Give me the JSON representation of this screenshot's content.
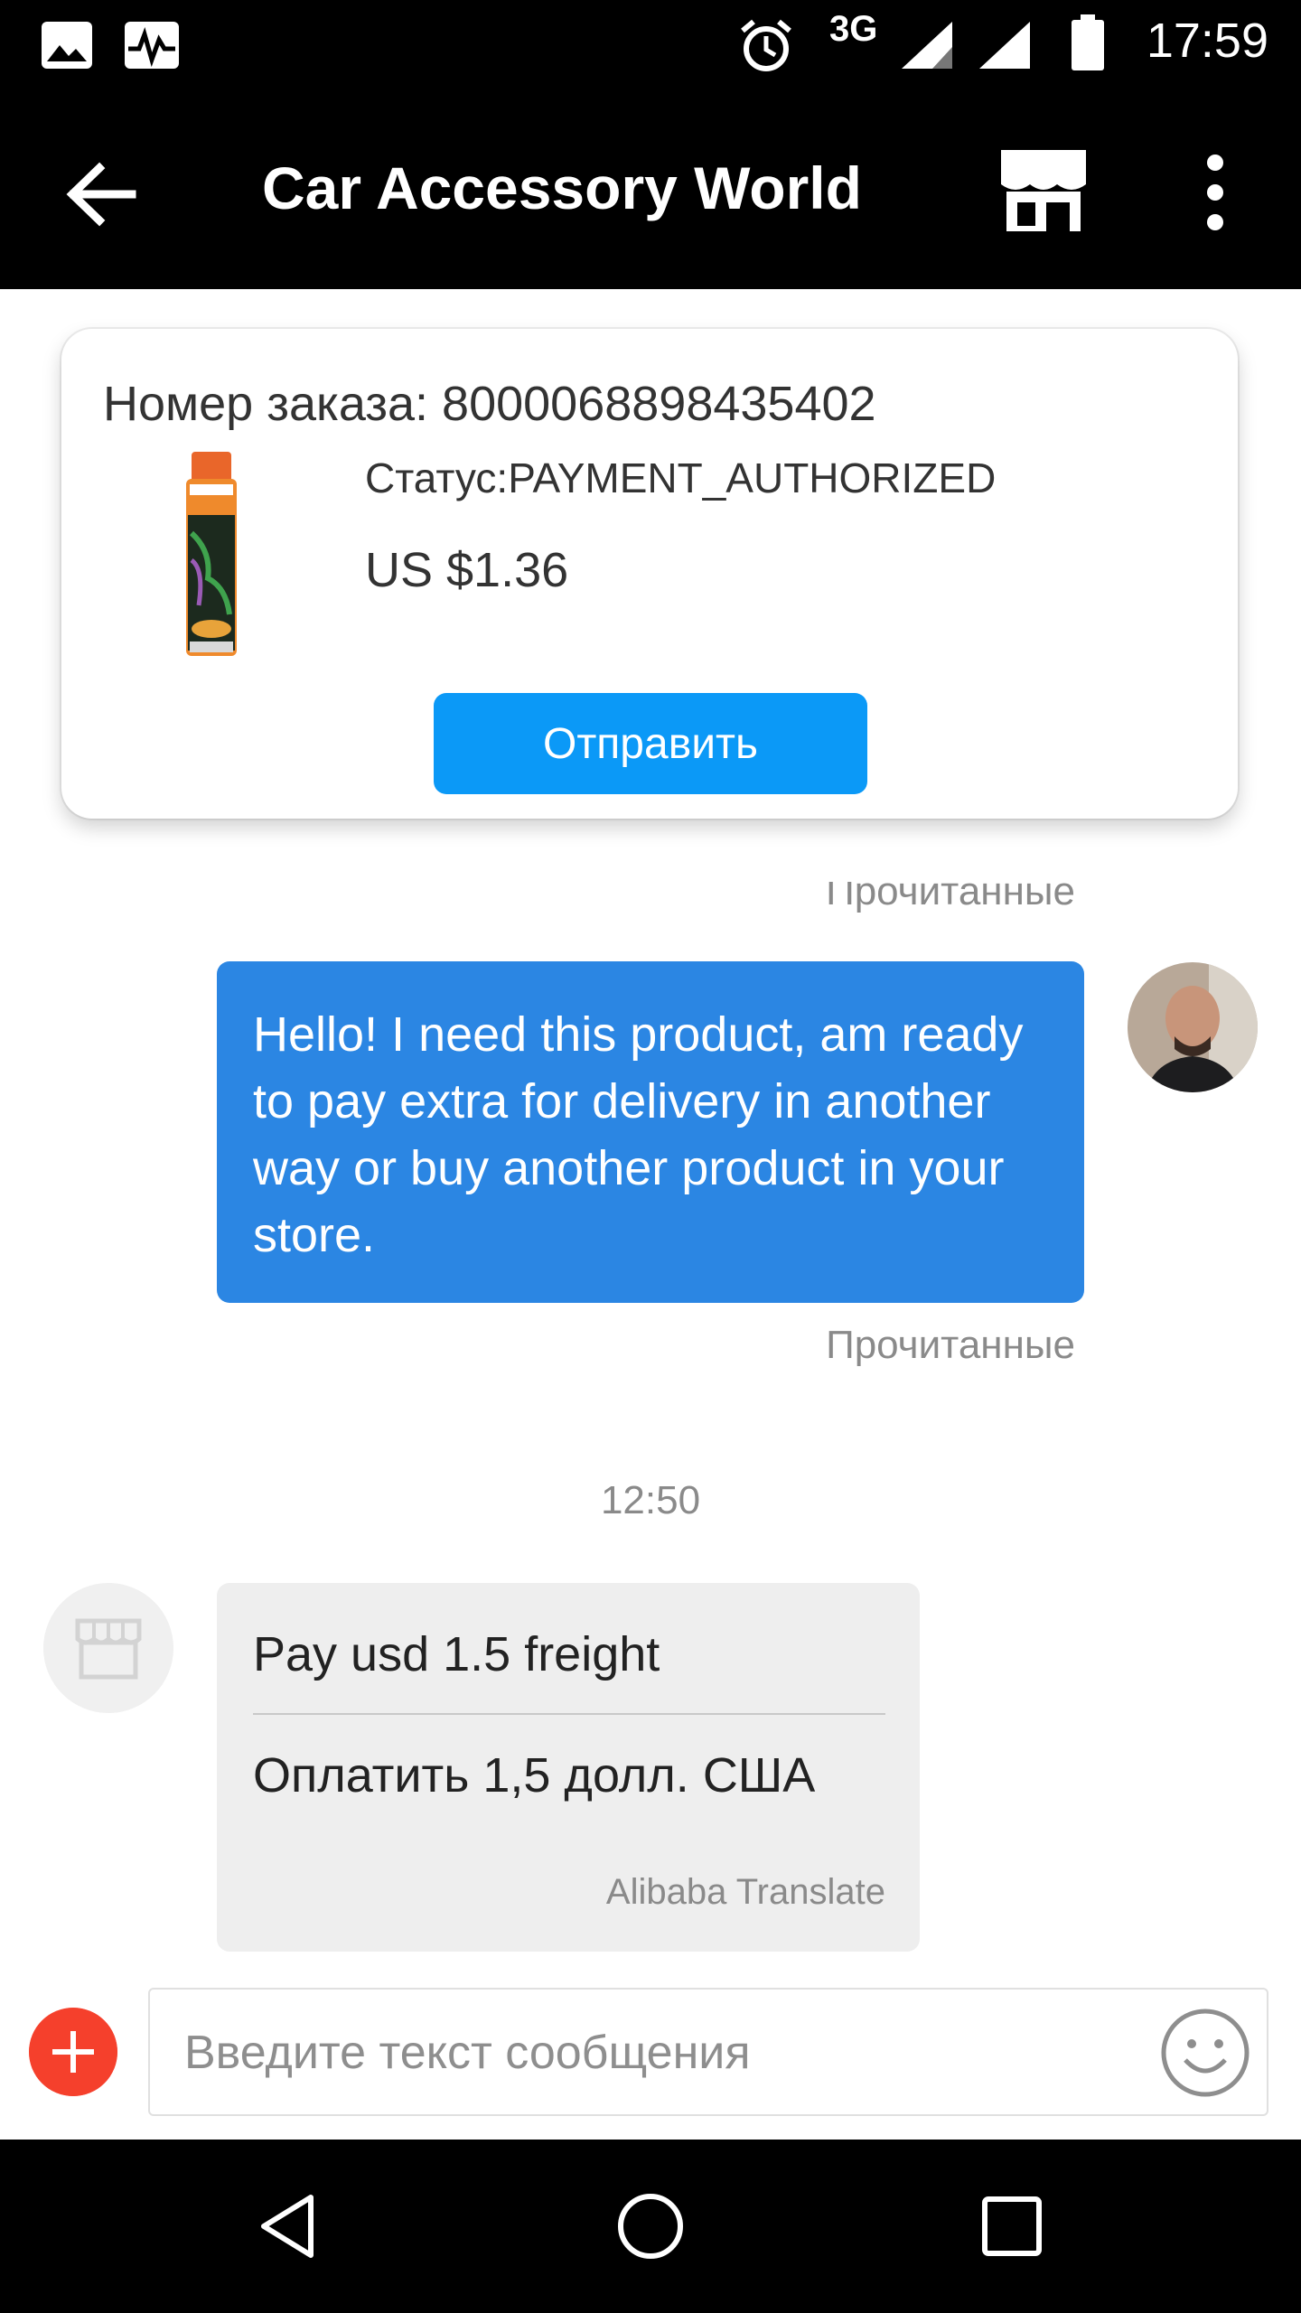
{
  "status_bar": {
    "time": "17:59",
    "network": "3G",
    "icons": [
      "image-icon",
      "activity-icon",
      "alarm-icon",
      "signal-icon",
      "signal-icon",
      "battery-icon"
    ]
  },
  "app_bar": {
    "title": "Car Accessory World",
    "icons": [
      "back-arrow-icon",
      "store-icon",
      "more-vertical-icon"
    ]
  },
  "order_card": {
    "order_number": "Номер заказа: 8000068898435402",
    "status": "Статус:PAYMENT_AUTHORIZED",
    "price": "US $1.36",
    "send_label": "Отправить"
  },
  "messages": {
    "read_label_top": "Прочитанные",
    "outgoing_text": "Hello!  I need this product, am ready to pay extra for delivery in another way or buy another product in your store.",
    "read_label_bottom": "Прочитанные",
    "timestamp": "12:50",
    "incoming_original": "Pay usd 1.5 freight",
    "incoming_translated": "Оплатить 1,5 долл. США",
    "translate_credit": "Alibaba Translate"
  },
  "input_bar": {
    "placeholder": "Введите текст сообщения",
    "add_icon": "plus-icon",
    "emoji_icon": "smiley-icon"
  },
  "nav_bar": {
    "icons": [
      "nav-back-icon",
      "nav-home-icon",
      "nav-recents-icon"
    ]
  },
  "colors": {
    "accent_button": "#0b99f7",
    "outgoing_bubble": "#2b86e3",
    "incoming_bubble": "#eeeeee",
    "add_button": "#f5402c"
  }
}
